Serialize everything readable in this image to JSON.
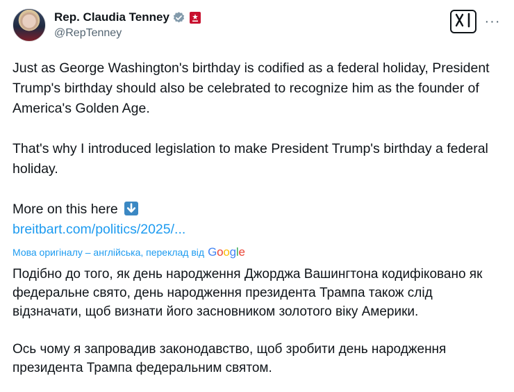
{
  "author": {
    "display_name": "Rep. Claudia Tenney",
    "handle": "@RepTenney",
    "avatar_icon": "avatar-photo",
    "verified_icon": "verified-badge-icon",
    "affiliation_icon": "government-badge-icon"
  },
  "actions": {
    "grok_icon": "xai-grok-icon",
    "more_icon": "more-options-icon",
    "more_label": "···"
  },
  "tweet": {
    "paragraph_1": "Just as George Washington's birthday is codified as a federal holiday, President Trump's birthday should also be celebrated to recognize him as the founder of America's Golden Age.",
    "paragraph_2": "That's why I introduced legislation to make President Trump's birthday a federal holiday.",
    "more_text": "More on this here",
    "arrow_icon": "down-arrow-emoji",
    "link_text": "breitbart.com/politics/2025/..."
  },
  "translation_notice": {
    "label": "Мова оригіналу – англійська, переклад від",
    "provider": "Google"
  },
  "translation": {
    "paragraph_1": "Подібно до того, як день народження Джорджа Вашингтона кодифіковано як федеральне свято, день народження президента Трампа також слід відзначати, щоб визнати його засновником золотого віку Америки.",
    "paragraph_2": "Ось чому я запровадив законодавство, щоб зробити день народження президента Трампа федеральним святом."
  },
  "colors": {
    "link": "#1d9bf0",
    "text": "#0f1419",
    "secondary": "#536471",
    "verified": "#829aab",
    "gov_badge": "#c8102e"
  }
}
